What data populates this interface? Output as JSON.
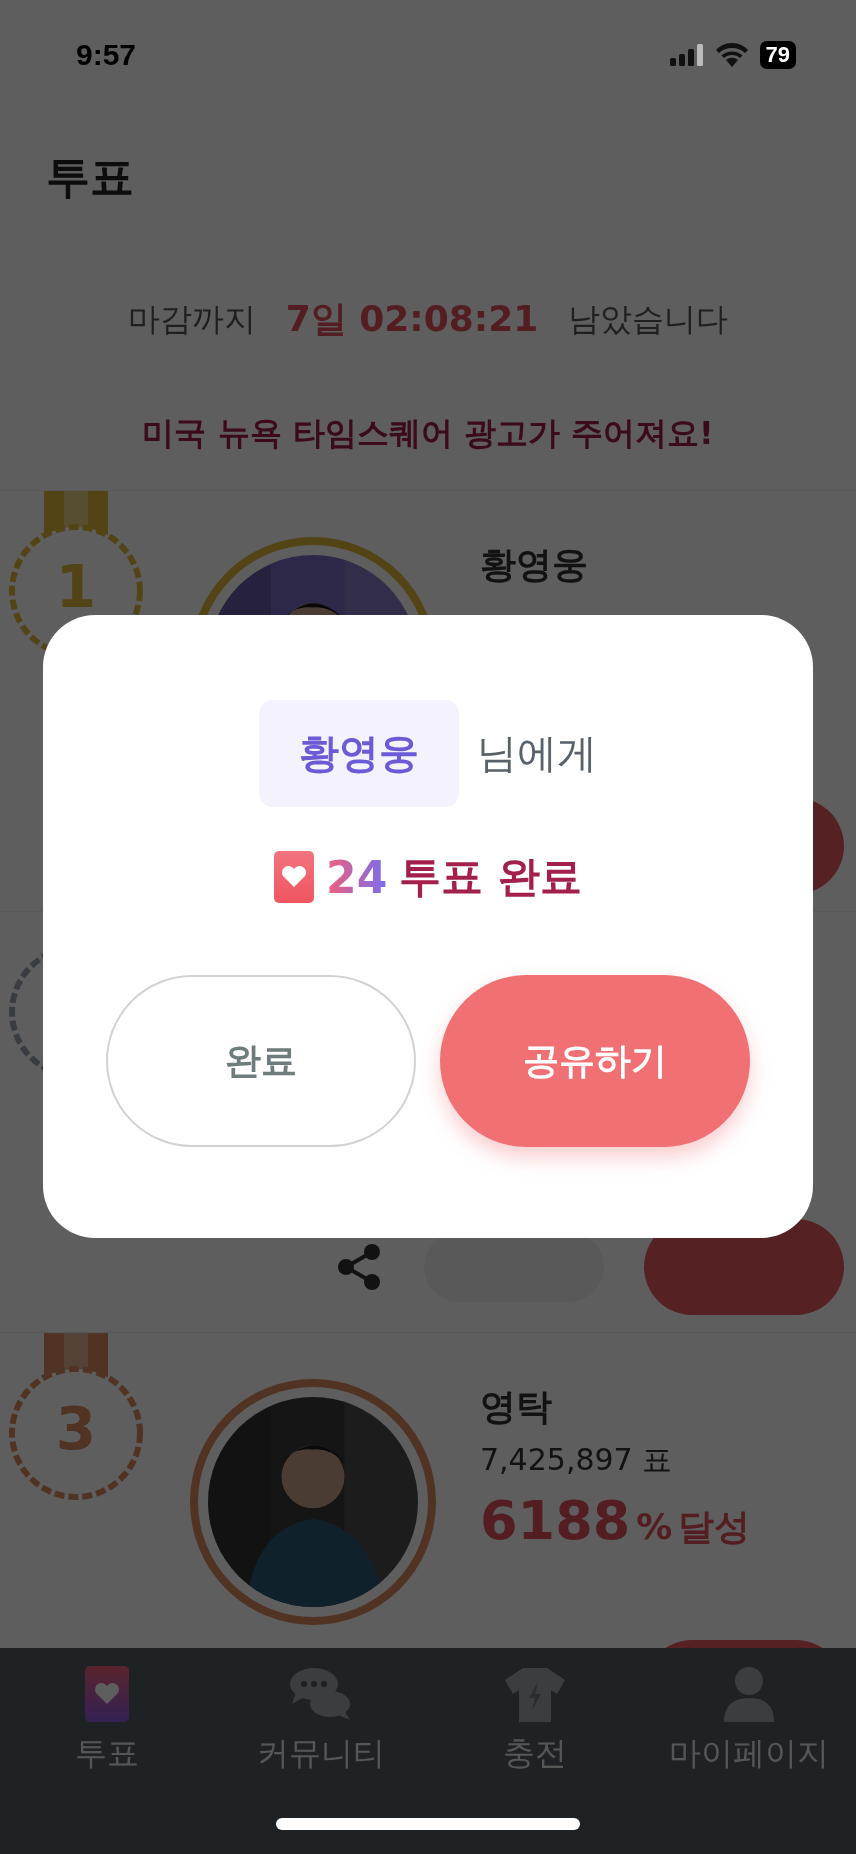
{
  "status_bar": {
    "time": "9:57",
    "battery": "79"
  },
  "header": {
    "title": "투표"
  },
  "countdown": {
    "prefix": "마감까지",
    "time": "7일 02:08:21",
    "suffix": "남았습니다"
  },
  "notice": "미국 뉴욕 타임스퀘어 광고가 주어져요!",
  "ranking": [
    {
      "rank": "1",
      "name": "황영웅",
      "kind": "gold"
    },
    {
      "kind": "silver"
    },
    {
      "rank": "3",
      "name": "영탁",
      "votes": "7,425,897 표",
      "percent": "6188",
      "percent_unit": "%",
      "percent_label": "달성",
      "kind": "bronze"
    }
  ],
  "dialog": {
    "recipient": "황영웅",
    "recipient_suffix": "님에게",
    "vote_count": "24",
    "vote_text": "투표 완료",
    "buttons": [
      {
        "label": "완료",
        "kind": "secondary"
      },
      {
        "label": "공유하기",
        "kind": "primary"
      }
    ]
  },
  "tab_bar": [
    {
      "label": "투표",
      "selected": true
    },
    {
      "label": "커뮤니티",
      "selected": false
    },
    {
      "label": "충전",
      "selected": false
    },
    {
      "label": "마이페이지",
      "selected": false
    }
  ]
}
